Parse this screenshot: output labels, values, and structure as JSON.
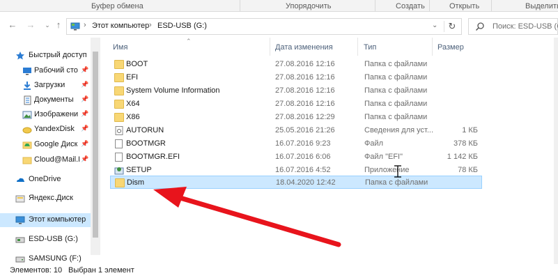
{
  "ribbon": {
    "groups": [
      "Буфер обмена",
      "Упорядочить",
      "Создать",
      "Открыть",
      "Выделить"
    ]
  },
  "address": {
    "crumbs": [
      "Этот компьютер",
      "ESD-USB (G:)"
    ],
    "search_placeholder": "Поиск: ESD-USB (G:)"
  },
  "nav": {
    "items": [
      {
        "label": "Быстрый доступ",
        "icon": "star-icon"
      },
      {
        "label": "Рабочий сто",
        "icon": "desktop-icon",
        "pinned": true
      },
      {
        "label": "Загрузки",
        "icon": "download-icon",
        "pinned": true
      },
      {
        "label": "Документы",
        "icon": "documents-icon",
        "pinned": true
      },
      {
        "label": "Изображени",
        "icon": "pictures-icon",
        "pinned": true
      },
      {
        "label": "YandexDisk",
        "icon": "yandexdisk-icon",
        "pinned": true
      },
      {
        "label": "Google Диск",
        "icon": "googledrive-icon",
        "pinned": true
      },
      {
        "label": "Cloud@Mail.F",
        "icon": "folder-icon",
        "pinned": true
      },
      {
        "label": "OneDrive",
        "icon": "onedrive-icon"
      },
      {
        "label": "Яндекс.Диск",
        "icon": "yandex-disk-icon"
      },
      {
        "label": "Этот компьютер",
        "icon": "computer-icon",
        "selected": true
      },
      {
        "label": "ESD-USB (G:)",
        "icon": "usb-drive-icon"
      },
      {
        "label": "SAMSUNG (F:)",
        "icon": "drive-icon"
      }
    ]
  },
  "columns": {
    "name": "Имя",
    "date": "Дата изменения",
    "type": "Тип",
    "size": "Размер"
  },
  "files": [
    {
      "name": "BOOT",
      "date": "27.08.2016 12:16",
      "type": "Папка с файлами",
      "size": "",
      "kind": "folder"
    },
    {
      "name": "EFI",
      "date": "27.08.2016 12:16",
      "type": "Папка с файлами",
      "size": "",
      "kind": "folder"
    },
    {
      "name": "System Volume Information",
      "date": "27.08.2016 12:16",
      "type": "Папка с файлами",
      "size": "",
      "kind": "folder"
    },
    {
      "name": "X64",
      "date": "27.08.2016 12:16",
      "type": "Папка с файлами",
      "size": "",
      "kind": "folder"
    },
    {
      "name": "X86",
      "date": "27.08.2016 12:29",
      "type": "Папка с файлами",
      "size": "",
      "kind": "folder"
    },
    {
      "name": "AUTORUN",
      "date": "25.05.2016 21:26",
      "type": "Сведения для уст...",
      "size": "1 КБ",
      "kind": "setup-info"
    },
    {
      "name": "BOOTMGR",
      "date": "16.07.2016 9:23",
      "type": "Файл",
      "size": "378 КБ",
      "kind": "file"
    },
    {
      "name": "BOOTMGR.EFI",
      "date": "16.07.2016 6:06",
      "type": "Файл \"EFI\"",
      "size": "1 142 КБ",
      "kind": "file"
    },
    {
      "name": "SETUP",
      "date": "16.07.2016 4:52",
      "type": "Приложение",
      "size": "78 КБ",
      "kind": "app"
    },
    {
      "name": "Dism",
      "date": "18.04.2020 12:42",
      "type": "Папка с файлами",
      "size": "",
      "kind": "folder",
      "selected": true
    }
  ],
  "status": {
    "count": "Элементов: 10",
    "selection": "Выбран 1 элемент"
  },
  "colors": {
    "selection": "#cce8ff",
    "selection_border": "#99d1ff",
    "folder": "#f8d775",
    "arrow": "#e8141c"
  }
}
